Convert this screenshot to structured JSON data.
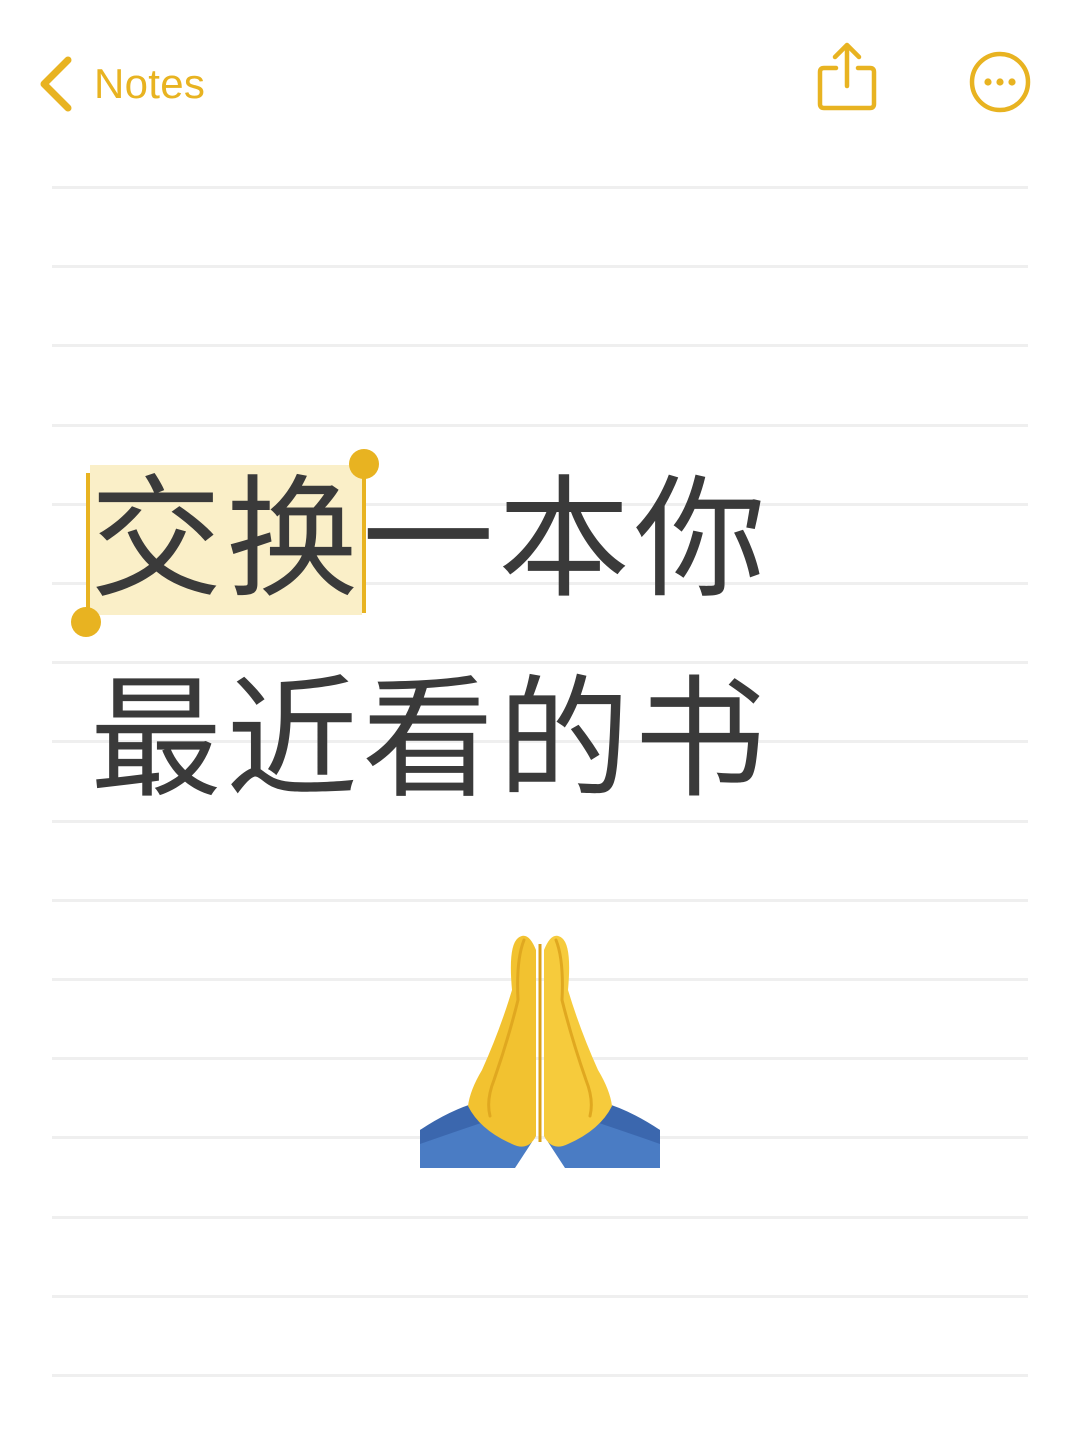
{
  "nav": {
    "back_label": "Notes",
    "back_icon": "chevron-left-icon",
    "share_icon": "share-icon",
    "more_icon": "more-ellipsis-icon"
  },
  "note": {
    "line1_selected": "交换",
    "line1_rest": "一本你",
    "line2": "最近看的书",
    "emoji": "folded-hands-icon"
  },
  "colors": {
    "accent": "#E8B321",
    "selection": "#FAEFC8",
    "text": "#3A3A3A",
    "rule": "#EFEFEF"
  }
}
